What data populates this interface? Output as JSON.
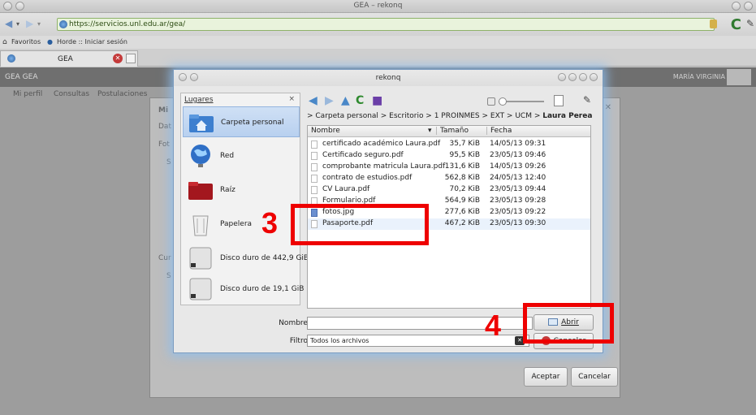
{
  "window": {
    "title": "GEA – rekonq"
  },
  "browser": {
    "url": "https://servicios.unl.edu.ar/gea/",
    "favorites": [
      {
        "label": "Favoritos"
      },
      {
        "label": "Horde :: Iniciar sesión"
      }
    ],
    "tab": {
      "label": "GEA"
    }
  },
  "page": {
    "brand": "GEA GEA",
    "user": "MARÍA VIRGINIA",
    "menu": [
      "Mi perfil",
      "Consultas",
      "Postulaciones"
    ],
    "ghost_labels": [
      "Mi",
      "Dat",
      "Fot",
      "S",
      "Cur",
      "S"
    ],
    "buttons": {
      "accept": "Aceptar",
      "cancel": "Cancelar"
    }
  },
  "file_dialog": {
    "title": "rekonq",
    "places": {
      "header": "Lugares",
      "items": [
        {
          "label": "Carpeta personal",
          "icon": "home-folder-icon",
          "selected": true
        },
        {
          "label": "Red",
          "icon": "network-globe-icon"
        },
        {
          "label": "Raíz",
          "icon": "root-folder-icon"
        },
        {
          "label": "Papelera",
          "icon": "trash-icon"
        },
        {
          "label": "Disco duro de 442,9 GiB",
          "icon": "hard-drive-icon"
        },
        {
          "label": "Disco duro de 19,1 GiB",
          "icon": "hard-drive-icon"
        }
      ]
    },
    "breadcrumb": {
      "prefix": "> Carpeta personal > Escritorio > 1 PROINMES > EXT > UCM >",
      "current": "Laura Perea"
    },
    "columns": {
      "name": "Nombre",
      "size": "Tamaño",
      "date": "Fecha"
    },
    "files": [
      {
        "name": "certificado académico Laura.pdf",
        "size": "35,7 KiB",
        "date": "14/05/13 09:31",
        "type": "pdf"
      },
      {
        "name": "Certificado seguro.pdf",
        "size": "95,5 KiB",
        "date": "23/05/13 09:46",
        "type": "pdf"
      },
      {
        "name": "comprobante matricula Laura.pdf",
        "size": "131,6 KiB",
        "date": "14/05/13 09:26",
        "type": "pdf"
      },
      {
        "name": "contrato de estudios.pdf",
        "size": "562,8 KiB",
        "date": "24/05/13 12:40",
        "type": "pdf"
      },
      {
        "name": "CV Laura.pdf",
        "size": "70,2 KiB",
        "date": "23/05/13 09:44",
        "type": "pdf"
      },
      {
        "name": "Formulario.pdf",
        "size": "564,9 KiB",
        "date": "23/05/13 09:28",
        "type": "pdf"
      },
      {
        "name": "fotos.jpg",
        "size": "277,6 KiB",
        "date": "23/05/13 09:22",
        "type": "img"
      },
      {
        "name": "Pasaporte.pdf",
        "size": "467,2 KiB",
        "date": "23/05/13 09:30",
        "type": "pdf"
      }
    ],
    "name_label": "Nombre:",
    "name_value": "",
    "filter_label": "Filtro:",
    "filter_value": "Todos los archivos",
    "buttons": {
      "open": "Abrir",
      "cancel": "Cancelar"
    }
  },
  "annotations": {
    "step3": "3",
    "step4": "4",
    "color": "#ee0000"
  }
}
